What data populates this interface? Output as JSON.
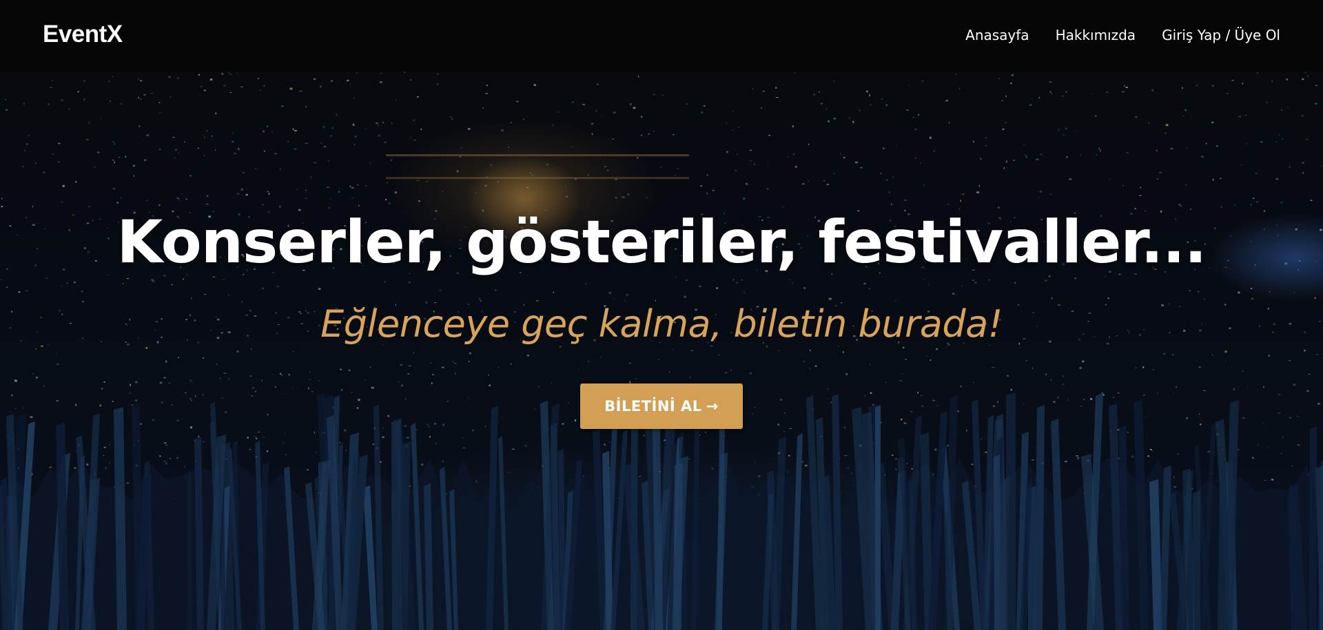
{
  "navbar": {
    "brand": "EventX",
    "links": [
      {
        "label": "Anasayfa"
      },
      {
        "label": "Hakkımızda"
      },
      {
        "label": "Giriş Yap / Üye Ol"
      }
    ]
  },
  "hero": {
    "headline": "Konserler, gösteriler, festivaller...",
    "subheadline": "Eğlenceye geç kalma, biletin burada!",
    "cta_label": "BİLETİNİ AL",
    "cta_icon": "arrow-right-icon",
    "background_image": "concert-crowd-photo"
  },
  "colors": {
    "accent": "#d39f55",
    "subheadline": "#d9a45a",
    "navbar_bg": "#050505"
  }
}
